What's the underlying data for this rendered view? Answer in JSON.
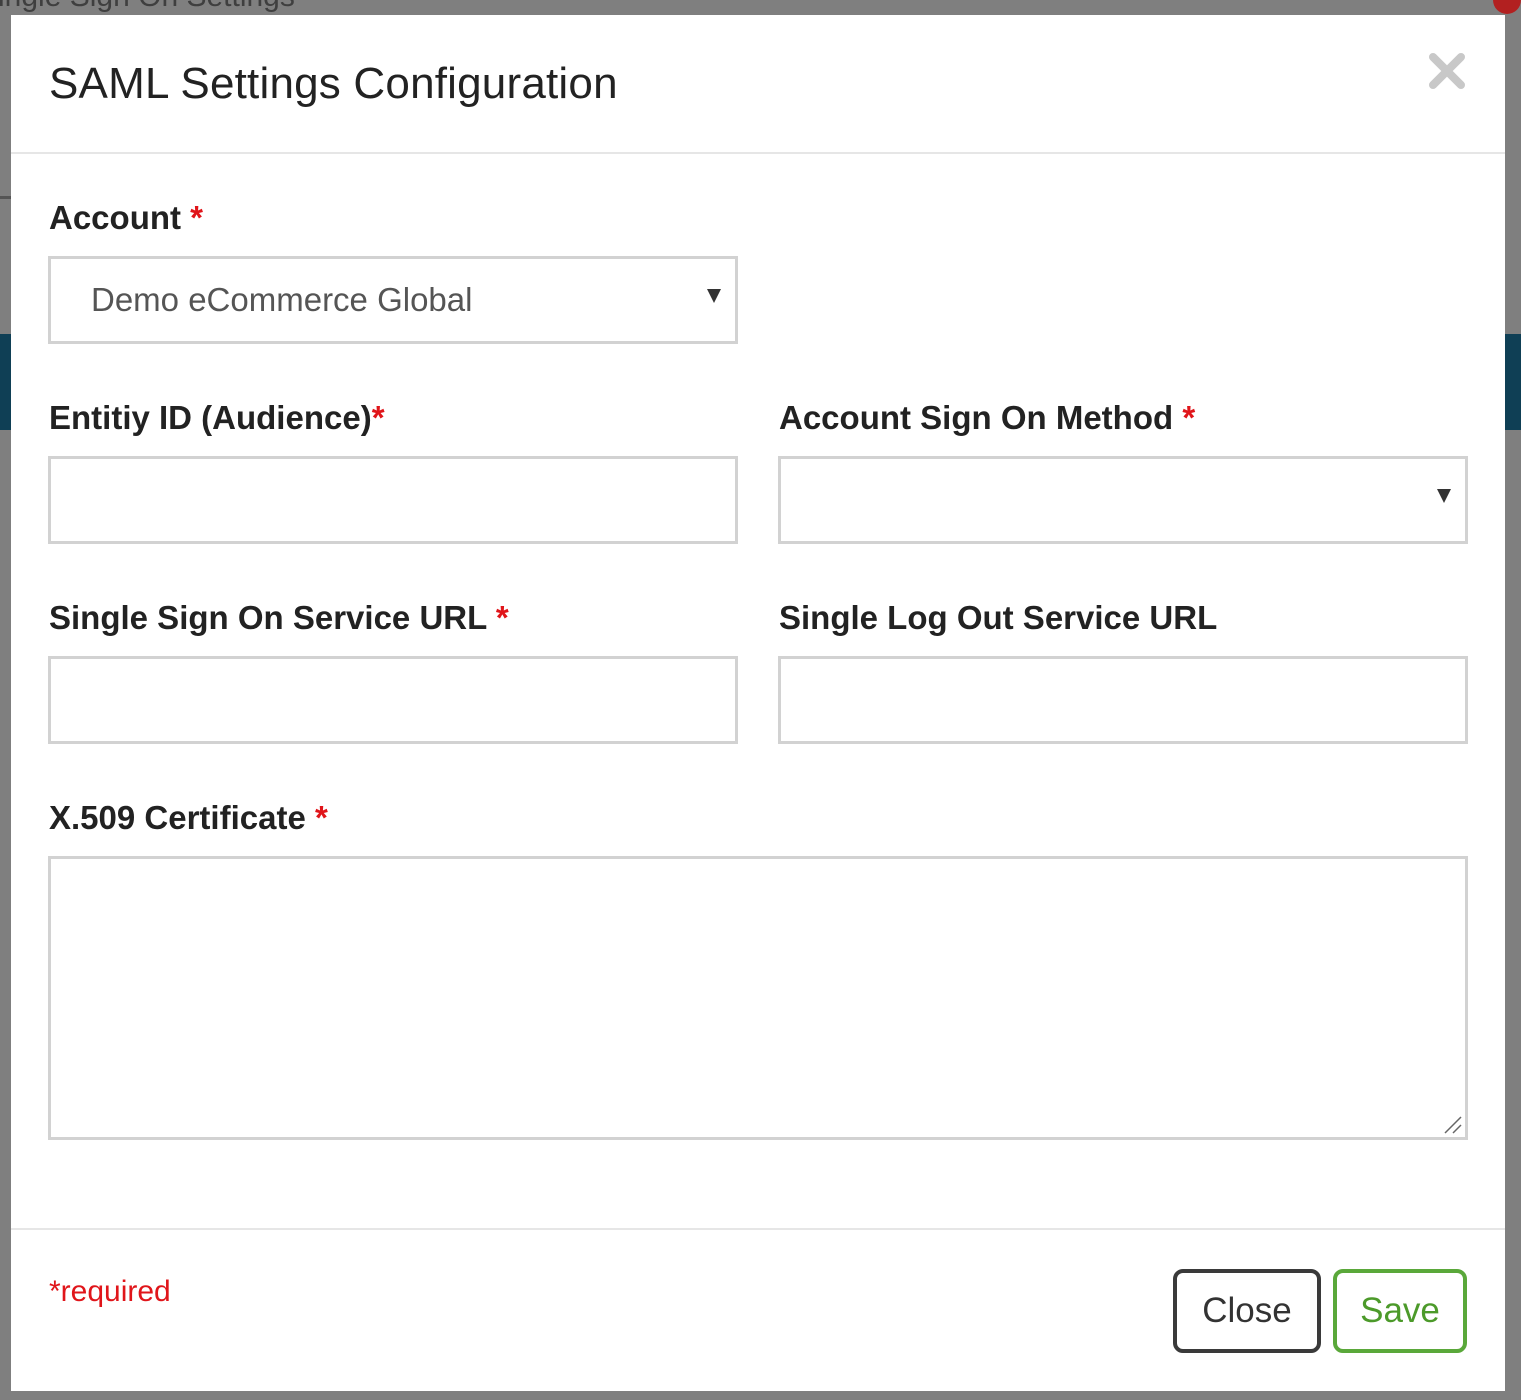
{
  "background": {
    "page_title": "Single Sign On Settings"
  },
  "modal": {
    "title": "SAML Settings Configuration",
    "close_icon": "close-icon"
  },
  "form": {
    "account": {
      "label": "Account",
      "required_mark": "*",
      "selected_value": "Demo eCommerce Global"
    },
    "entity_id": {
      "label": "Entitiy ID (Audience)",
      "required_mark": "*",
      "value": ""
    },
    "sign_on_method": {
      "label": "Account Sign On Method",
      "required_mark": "*",
      "selected_value": ""
    },
    "sso_url": {
      "label": "Single Sign On Service URL",
      "required_mark": "*",
      "value": ""
    },
    "slo_url": {
      "label": "Single Log Out Service URL",
      "value": ""
    },
    "certificate": {
      "label": "X.509 Certificate",
      "required_mark": "*",
      "value": ""
    }
  },
  "footer": {
    "required_note": "*required",
    "close_label": "Close",
    "save_label": "Save"
  },
  "colors": {
    "required": "#e0151a",
    "save_accent": "#5aa83a",
    "background_strip": "#0f3f55"
  }
}
